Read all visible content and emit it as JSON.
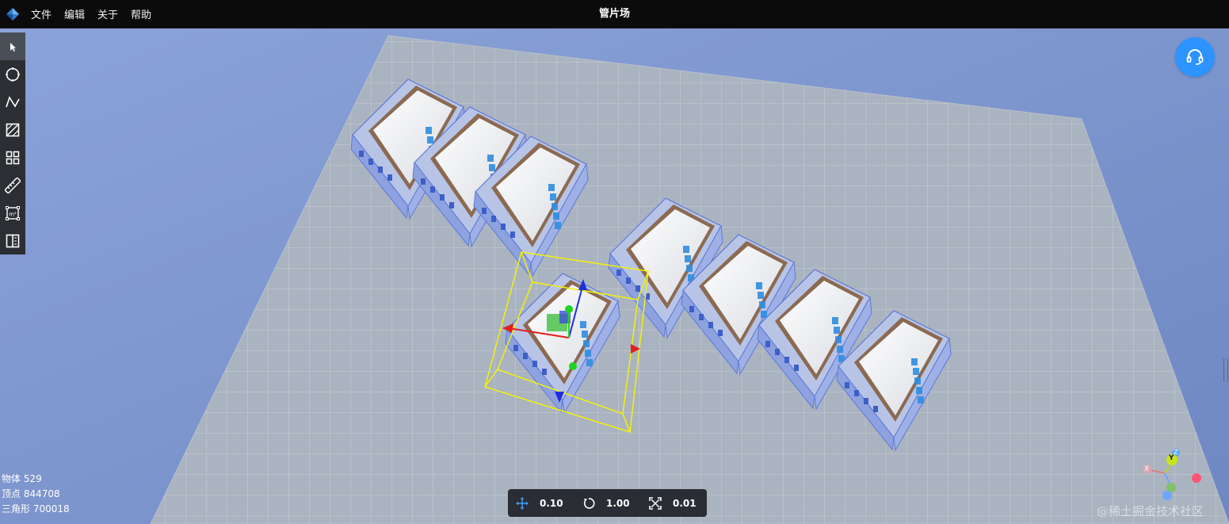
{
  "menu": {
    "file": "文件",
    "edit": "编辑",
    "about": "关于",
    "help": "帮助"
  },
  "app": {
    "title": "管片场"
  },
  "toolbar": {
    "tools": [
      {
        "name": "select-icon",
        "active": true
      },
      {
        "name": "circle-icon"
      },
      {
        "name": "polyline-icon"
      },
      {
        "name": "polygon-icon"
      },
      {
        "name": "grid-icon"
      },
      {
        "name": "ruler-icon"
      },
      {
        "name": "area-measure-icon"
      },
      {
        "name": "split-view-icon"
      }
    ]
  },
  "stats": {
    "objects": "物体 529",
    "vertices": "顶点 844708",
    "triangles": "三角形 700018"
  },
  "transform": {
    "move_step": "0.10",
    "rotate_step": "1.00",
    "scale_step": "0.01"
  },
  "axes": {
    "x": "X",
    "y": "Y",
    "z": "Z"
  },
  "watermark": "@稀土掘金技术社区",
  "colors": {
    "topbar": "#0b0b0b",
    "viewport_bg": "#7f95c9",
    "ground": "#aab3c0",
    "selection_box": "#f2f20a",
    "support_button": "#2c93ff"
  }
}
